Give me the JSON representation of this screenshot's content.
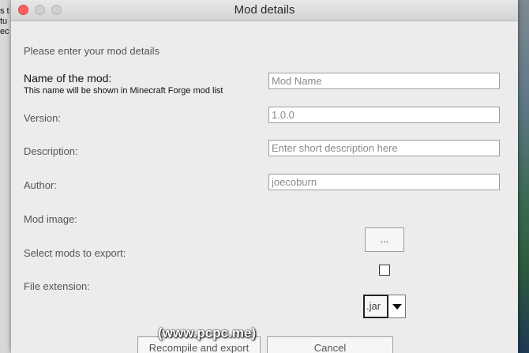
{
  "background": {
    "left_text": "s t\ntu\nec"
  },
  "window": {
    "title": "Mod details"
  },
  "form": {
    "intro": "Please enter your mod details",
    "name_label": "Name of the mod:",
    "name_hint": "This name will be shown in Minecraft Forge mod list",
    "name_placeholder": "Mod Name",
    "version_label": "Version:",
    "version_value": "1.0.0",
    "description_label": "Description:",
    "description_placeholder": "Enter short description here",
    "author_label": "Author:",
    "author_value": "joecoburn",
    "mod_image_label": "Mod image:",
    "mod_image_button": "...",
    "select_mods_label": "Select mods to export:",
    "select_mods_checked": false,
    "file_extension_label": "File extension:",
    "file_extension_value": ".jar"
  },
  "buttons": {
    "export": "Recompile and export",
    "cancel": "Cancel"
  },
  "watermark": "(www.pcpc.me)",
  "colors": {
    "close": "#fc605c",
    "window_bg": "#ececec"
  }
}
